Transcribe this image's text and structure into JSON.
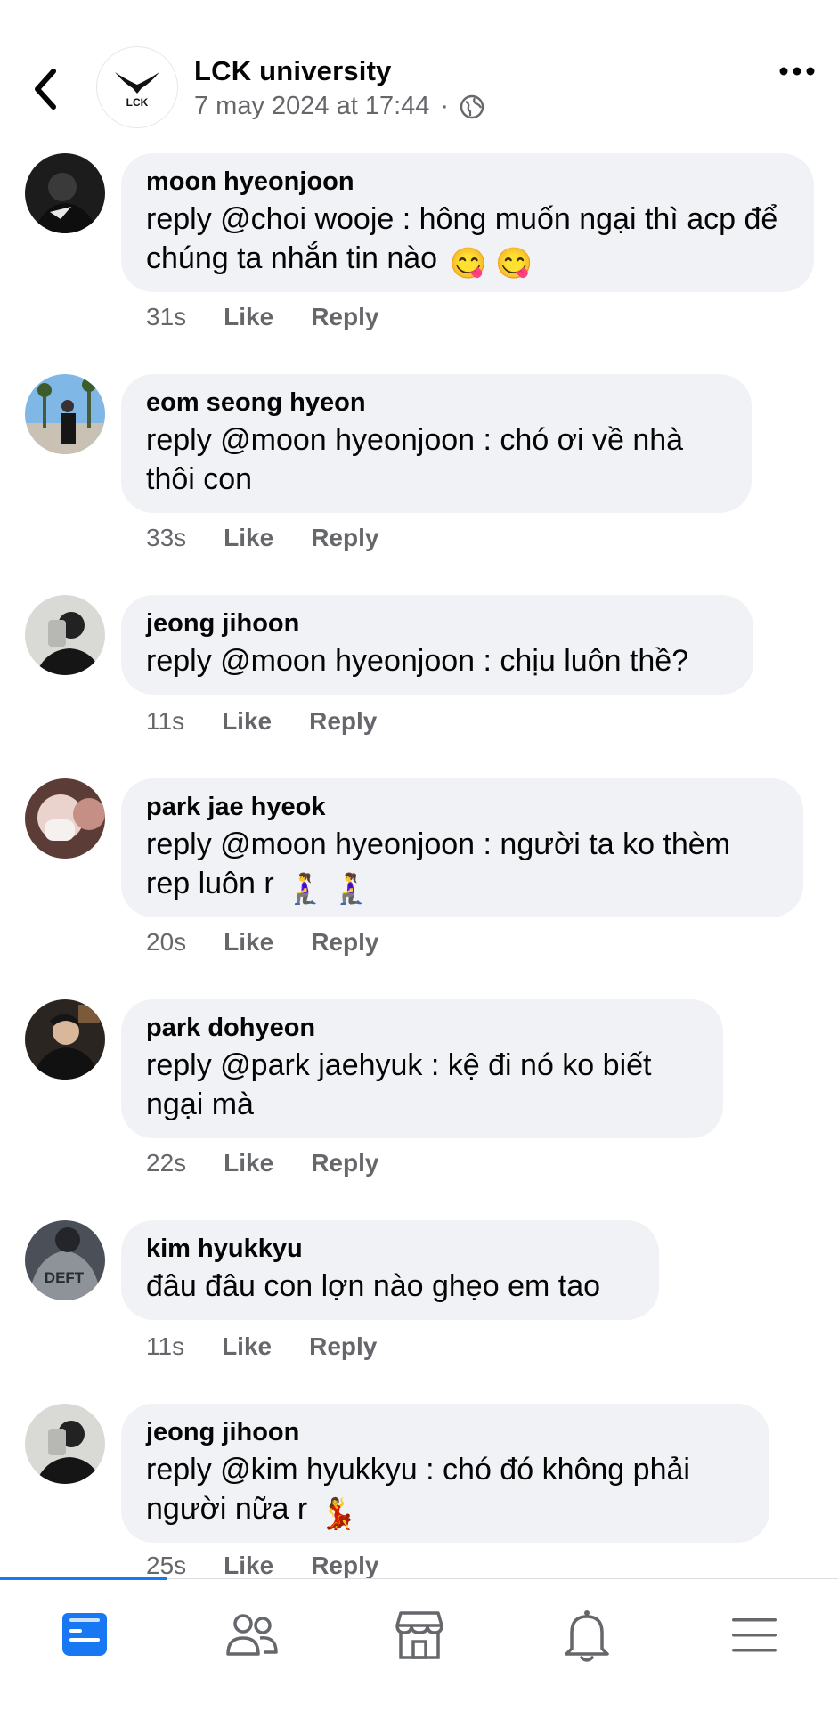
{
  "header": {
    "page_name": "LCK university",
    "timestamp": "7 may 2024 at 17:44",
    "separator": "·",
    "logo_text": "LCK"
  },
  "comments": [
    {
      "name": "moon hyeonjoon",
      "text": "reply @choi wooje : hông muốn ngại thì acp để chúng ta nhắn tin nào",
      "emoji": "😋 😋",
      "time": "31s",
      "like": "Like",
      "reply": "Reply"
    },
    {
      "name": "eom seong hyeon",
      "text": "reply @moon hyeonjoon : chó ơi về nhà thôi con",
      "emoji": "",
      "time": "33s",
      "like": "Like",
      "reply": "Reply"
    },
    {
      "name": "jeong jihoon",
      "text": "reply @moon hyeonjoon : chịu luôn thề?",
      "emoji": "",
      "time": "11s",
      "like": "Like",
      "reply": "Reply"
    },
    {
      "name": "park jae hyeok",
      "text": "reply @moon hyeonjoon : người ta ko thèm rep luôn r",
      "emoji": "🧎‍♀️ 🧎‍♀️",
      "time": "20s",
      "like": "Like",
      "reply": "Reply"
    },
    {
      "name": "park dohyeon",
      "text": "reply @park jaehyuk : kệ đi nó ko biết ngại mà",
      "emoji": "",
      "time": "22s",
      "like": "Like",
      "reply": "Reply"
    },
    {
      "name": "kim hyukkyu",
      "text": "đâu đâu con lợn nào ghẹo em tao",
      "emoji": "",
      "time": "11s",
      "like": "Like",
      "reply": "Reply"
    },
    {
      "name": "jeong jihoon",
      "text": "reply @kim hyukkyu : chó đó không phải người nữa r",
      "emoji": "💃",
      "time": "25s",
      "like": "Like",
      "reply": "Reply"
    }
  ],
  "avatars": [
    "profile-photo",
    "profile-photo",
    "profile-photo",
    "profile-photo",
    "profile-photo",
    "deft-jacket-photo",
    "profile-photo"
  ],
  "avatar_deft_text": "DEFT",
  "tabbar": {
    "tabs": [
      "home-feed-icon",
      "friends-icon",
      "marketplace-icon",
      "notifications-icon",
      "menu-icon"
    ],
    "active_color": "#1877f2",
    "inactive_color": "#65676b"
  },
  "colors": {
    "bubble": "#f0f2f5",
    "secondary_text": "#65676b",
    "accent": "#1877f2"
  }
}
